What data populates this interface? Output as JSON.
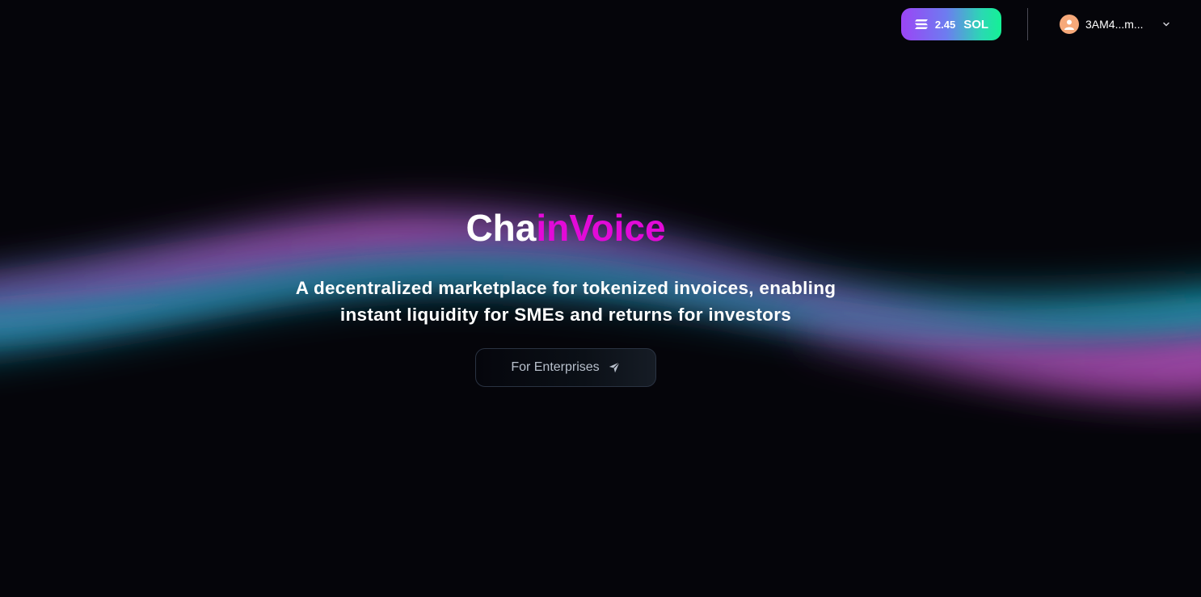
{
  "header": {
    "balance": {
      "amount": "2.45",
      "unit": "SOL",
      "icon": "solana-icon"
    },
    "account": {
      "address": "3AM4...m...",
      "avatar_icon": "user-icon",
      "dropdown_icon": "chevron-down-icon"
    }
  },
  "hero": {
    "title_part1": "Cha",
    "title_part2": "inVoice",
    "tagline_line1": "A decentralized marketplace for tokenized invoices, enabling",
    "tagline_line2": "instant liquidity for SMEs and returns for investors",
    "cta_label": "For Enterprises",
    "cta_icon": "send-icon"
  },
  "colors": {
    "background": "#05050a",
    "brand_magenta": "#e20ad8",
    "aurora_pink": "#c04bc0",
    "aurora_teal": "#1a8aa0",
    "sol_gradient_start": "#9b45f5",
    "sol_gradient_end": "#14f195"
  }
}
